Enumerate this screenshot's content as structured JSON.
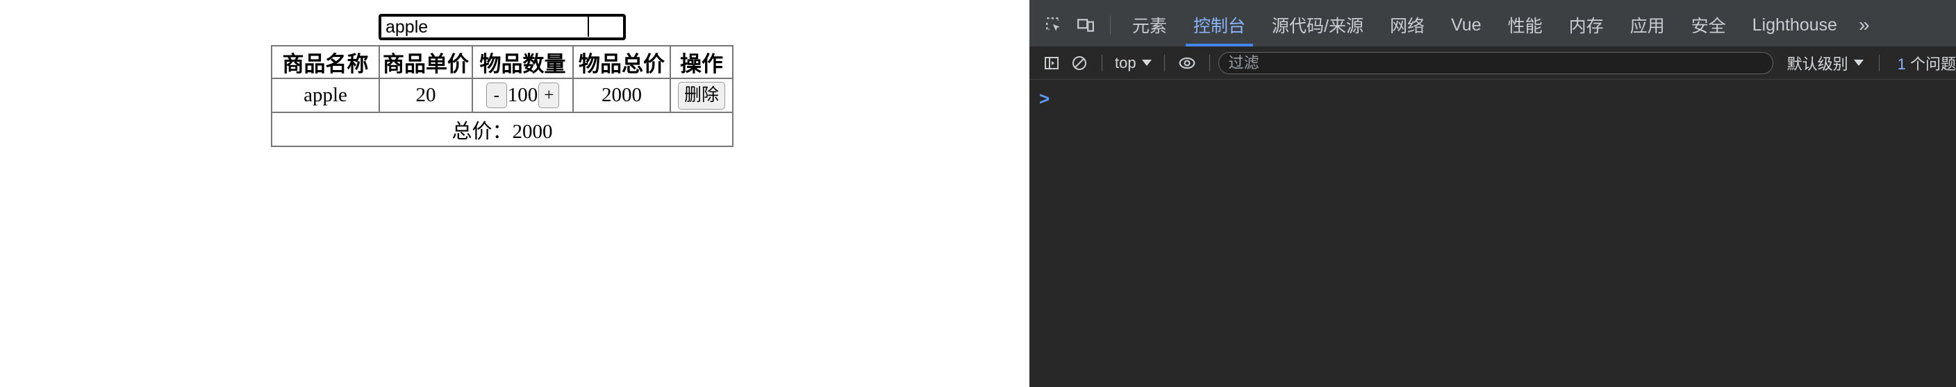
{
  "page": {
    "name_input": {
      "value": "apple",
      "placeholder": ""
    },
    "table": {
      "headers": [
        "商品名称",
        "商品单价",
        "物品数量",
        "物品总价",
        "操作"
      ],
      "rows": [
        {
          "name": "apple",
          "unit_price": "20",
          "decrement_label": "-",
          "quantity": "100",
          "increment_label": "+",
          "line_total": "2000",
          "delete_label": "删除"
        }
      ],
      "footer": "总价：2000"
    }
  },
  "devtools": {
    "toolbar_icons": [
      "inspect-element-icon",
      "device-toolbar-icon"
    ],
    "tabs": [
      {
        "label": "元素",
        "active": false
      },
      {
        "label": "控制台",
        "active": true
      },
      {
        "label": "源代码/来源",
        "active": false
      },
      {
        "label": "网络",
        "active": false
      },
      {
        "label": "Vue",
        "active": false
      },
      {
        "label": "性能",
        "active": false
      },
      {
        "label": "内存",
        "active": false
      },
      {
        "label": "应用",
        "active": false
      },
      {
        "label": "安全",
        "active": false
      },
      {
        "label": "Lighthouse",
        "active": false
      }
    ],
    "tabs_overflow_label": "»",
    "console_toolbar": {
      "sidebar_toggle_icon": "console-sidebar-icon",
      "clear_icon": "clear-console-icon",
      "context": "top",
      "eye_icon": "live-expression-icon",
      "filter_placeholder": "过滤",
      "filter_value": "",
      "level": "默认级别",
      "issues_count": "1",
      "issues_label": "个问题"
    },
    "prompt_symbol": ">"
  },
  "colors": {
    "accent_blue": "#8ab4f8",
    "tab_underline": "#4285f4",
    "devtools_tabbar_bg": "#3c4043",
    "devtools_body_bg": "#282828",
    "page_bg": "#ffffff",
    "table_border": "#777777"
  }
}
